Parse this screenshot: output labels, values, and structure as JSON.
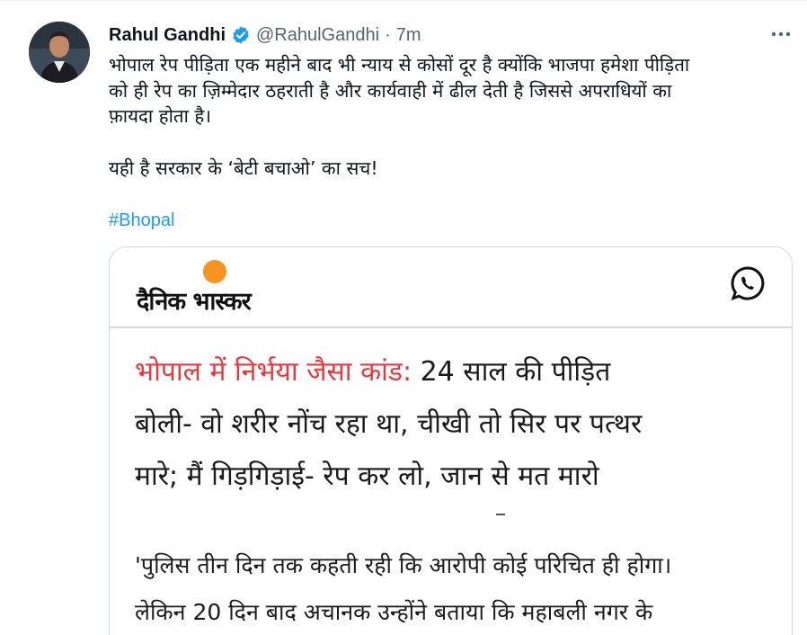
{
  "tweet": {
    "display_name": "Rahul Gandhi",
    "handle": "@RahulGandhi",
    "separator": "·",
    "time": "7m",
    "text_lines": [
      "भोपाल रेप पीड़िता एक महीने बाद भी न्याय से कोसों दूर है क्योंकि भाजपा हमेशा पीड़िता",
      "को ही रेप का ज़िम्मेदार ठहराती है और कार्यवाही में ढील देती है जिससे अपराधियों का",
      "फ़ायदा होता है।"
    ],
    "text_line2": "यही है सरकार के ‘बेटी बचाओ’ का सच!",
    "hashtag": "#Bhopal",
    "colors": {
      "link": "#1d9bf0",
      "verified": "#1d9bf0",
      "muted": "#536471"
    }
  },
  "card": {
    "brand": "दैनिक भास्कर",
    "headline_red": "भोपाल में निर्भया जैसा कांड:",
    "headline_line1_rest": " 24 साल की पीड़ित",
    "headline_line2": "बोली- वो शरीर नोंच रहा था, चीखी तो सिर पर पत्थर",
    "headline_line3": "मारे; मैं गिड़गिड़ाई- रेप कर लो, जान से मत मारो",
    "quote_line1": "'पुलिस तीन दिन तक कहती रही कि आरोपी कोई परिचित ही होगा।",
    "quote_line2": "लेकिन 20 दिन बाद अचानक उन्होंने बताया कि महाबली नगर के",
    "colors": {
      "headline_red": "#e8383d",
      "sun": "#f7931e"
    }
  },
  "icons": {
    "verified": "verified-badge-icon",
    "more": "more-options-icon",
    "whatsapp": "whatsapp-icon"
  }
}
